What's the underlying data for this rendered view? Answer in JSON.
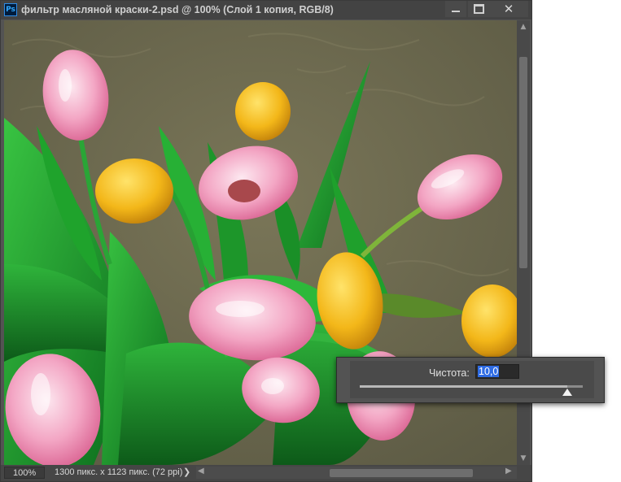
{
  "window": {
    "app_icon": "Ps",
    "title": "фильтр масляной краски-2.psd @ 100% (Слой 1 копия, RGB/8)",
    "close_glyph": "✕"
  },
  "statusbar": {
    "zoom": "100%",
    "doc_info": "1300 пикс. x 1123 пикс. (72 ppi)",
    "arrow": "❯"
  },
  "popup": {
    "label": "Чистота:",
    "value": "10,0",
    "slider_level": 0.93
  },
  "colors": {
    "accent_selection": "#2f6ce4",
    "panel_bg": "#535353"
  },
  "canvas": {
    "content": "oil-painting filter image of pink and yellow tulips"
  }
}
